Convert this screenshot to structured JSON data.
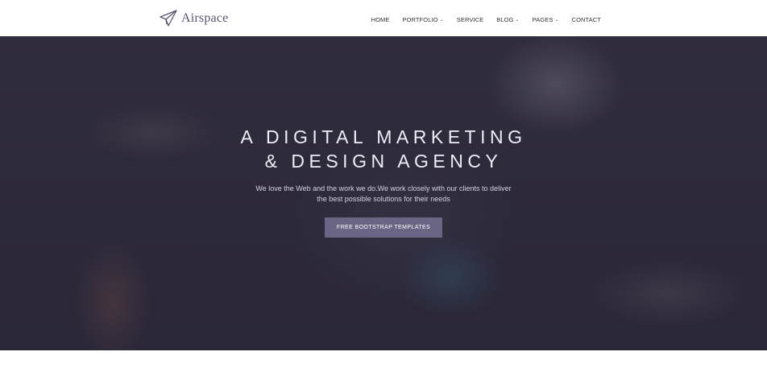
{
  "header": {
    "logo_text": "Airspace",
    "logo_icon": "paper-plane-icon",
    "nav": [
      {
        "label": "HOME",
        "dropdown": false
      },
      {
        "label": "PORTFOLIO",
        "dropdown": true
      },
      {
        "label": "SERVICE",
        "dropdown": false
      },
      {
        "label": "BLOG",
        "dropdown": true
      },
      {
        "label": "PAGES",
        "dropdown": true
      },
      {
        "label": "CONTACT",
        "dropdown": false
      }
    ]
  },
  "hero": {
    "title_line1": "A DIGITAL MARKETING",
    "title_line2": "& DESIGN AGENCY",
    "subtitle_line1": "We love the Web and the work we do.We work closely with our clients to deliver",
    "subtitle_line2": "the best possible solutions for their needs",
    "button_label": "FREE BOOTSTRAP TEMPLATES"
  },
  "colors": {
    "accent": "#6a6585",
    "logo": "#5a5470",
    "hero_overlay": "#2f2b3d"
  }
}
